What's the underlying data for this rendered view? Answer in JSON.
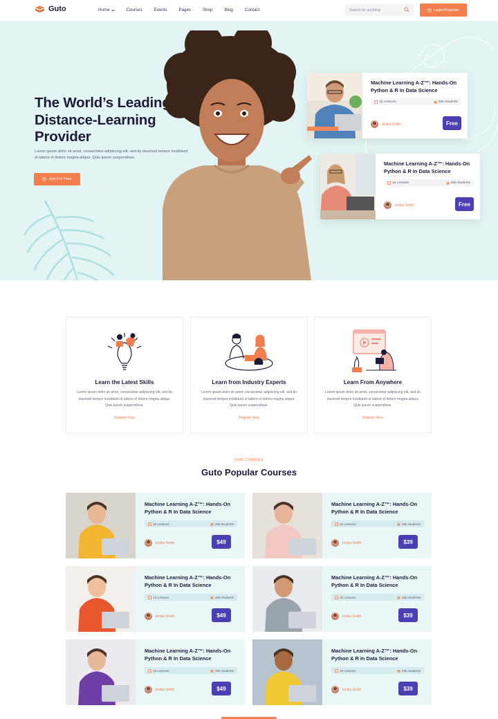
{
  "header": {
    "logo_text": "Guto",
    "nav": [
      "Home",
      "Courses",
      "Events",
      "Pages",
      "Shop",
      "Blog",
      "Contact"
    ],
    "search_placeholder": "Search for anything",
    "login_label": "Login/Register"
  },
  "hero": {
    "title_line1": "The World’s Leading",
    "title_line2": "Distance-Learning",
    "title_line3": "Provider",
    "description": "Lorem ipsum dolor sit amet, consectetur adipiscing elit, sed do eiusmod tempor incididunt ut labore et dolore magna aliqua. Quis ipsum suspendisse.",
    "cta_label": "Join For Free",
    "cards": [
      {
        "title": "Machine Learning A-Z™: Hands-On Python & R In Data Science",
        "lessons": "15 Lessons",
        "students": "255 Students",
        "author": "Jesika Smith",
        "price": "Free"
      },
      {
        "title": "Machine Learning A-Z™: Hands-On Python & R In Data Science",
        "lessons": "15 Lessons",
        "students": "255 Students",
        "author": "Jesika Smith",
        "price": "Free"
      }
    ]
  },
  "features": [
    {
      "title": "Learn the Latest Skills",
      "description": "Lorem ipsum dolor sit amet, consectetur adipiscing elit, sed do eiusmod tempor incididunt ut labore et dolore magna aliqua. Quis ipsum suspendisse.",
      "link": "Register Now"
    },
    {
      "title": "Learn from Industry Experts",
      "description": "Lorem ipsum dolor sit amet, consectetur adipiscing elit, sed do eiusmod tempor incididunt ut labore et dolore magna aliqua. Quis ipsum suspendisse.",
      "link": "Register Now"
    },
    {
      "title": "Learn From Anywhere",
      "description": "Lorem ipsum dolor sit amet, consectetur adipiscing elit, sed do eiusmod tempor incididunt ut labore et dolore magna aliqua. Quis ipsum suspendisse.",
      "link": "Register Now"
    }
  ],
  "courses_section": {
    "subtitle": "OUR COURSES",
    "title": "Guto Popular Courses",
    "courses": [
      {
        "title": "Machine Learning A-Z™: Hands-On Python & R In Data Science",
        "lessons": "15 Lessons",
        "students": "255 Students",
        "author": "Jesika Smith",
        "price": "$49"
      },
      {
        "title": "Machine Learning A-Z™: Hands-On Python & R In Data Science",
        "lessons": "15 Lessons",
        "students": "255 Students",
        "author": "Jesika Smith",
        "price": "$39"
      },
      {
        "title": "Machine Learning A-Z™: Hands-On Python & R In Data Science",
        "lessons": "15 Lessons",
        "students": "255 Students",
        "author": "Jesika Smith",
        "price": "$49"
      },
      {
        "title": "Machine Learning A-Z™: Hands-On Python & R In Data Science",
        "lessons": "15 Lessons",
        "students": "255 Students",
        "author": "Jesika Smith",
        "price": "$39"
      },
      {
        "title": "Machine Learning A-Z™: Hands-On Python & R In Data Science",
        "lessons": "15 Lessons",
        "students": "255 Students",
        "author": "Jesika Smith",
        "price": "$49"
      },
      {
        "title": "Machine Learning A-Z™: Hands-On Python & R In Data Science",
        "lessons": "15 Lessons",
        "students": "255 Students",
        "author": "Jesika Smith",
        "price": "$39"
      }
    ]
  },
  "colors": {
    "accent": "#f27d4d",
    "primary": "#4a3fb3",
    "hero_bg": "#e2f4f4",
    "card_bg": "#e9f8f7"
  },
  "icons": [
    "book-icon",
    "search-icon",
    "user-icon",
    "lessons-icon",
    "students-icon",
    "chevron-down-icon"
  ]
}
